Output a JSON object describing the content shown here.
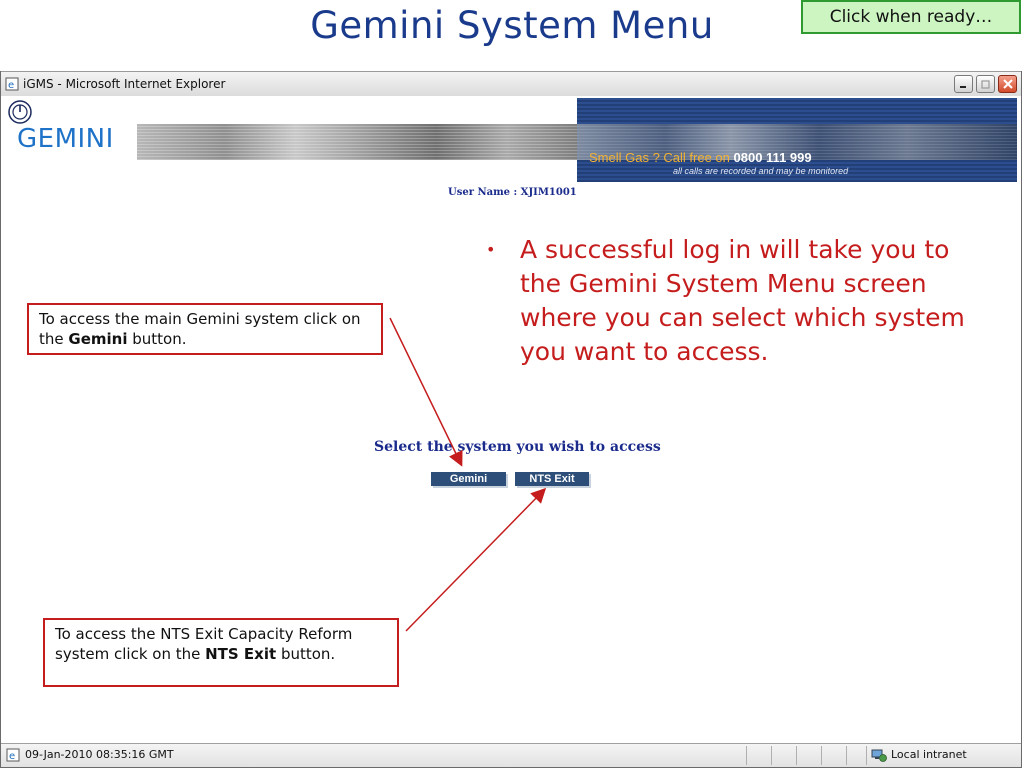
{
  "slide": {
    "title": "Gemini System Menu",
    "ready_button": "Click when ready…"
  },
  "browser": {
    "window_title": "iGMS - Microsoft Internet Explorer",
    "status_text": "09-Jan-2010  08:35:16 GMT",
    "zone_text": "Local intranet"
  },
  "gemini_page": {
    "logo": "GEMINI",
    "smell_gas_prefix": "Smell Gas ? Call free on ",
    "phone": "0800 111 999",
    "recorded_note": "all calls are recorded and may be monitored",
    "user_name": "User Name : XJIM1001",
    "select_prompt": "Select the system you wish to access",
    "gemini_button": "Gemini",
    "nts_exit_button": "NTS Exit"
  },
  "annotations": {
    "bullet": "A successful log in will take you to the Gemini System Menu screen where you can select which system you want to access.",
    "callout_gemini": {
      "prefix": "To access the main Gemini system click on the ",
      "bold": "Gemini",
      "suffix": " button."
    },
    "callout_nts": {
      "prefix": "To access the NTS Exit Capacity Reform system click on the ",
      "bold": "NTS Exit",
      "suffix": " button."
    }
  },
  "colors": {
    "title": "#1a3a8c",
    "annotation_red": "#c51d1d",
    "ready_green": "#ccf5c2",
    "gemini_blue": "#1e72c8",
    "button_navy": "#2c4e78"
  }
}
